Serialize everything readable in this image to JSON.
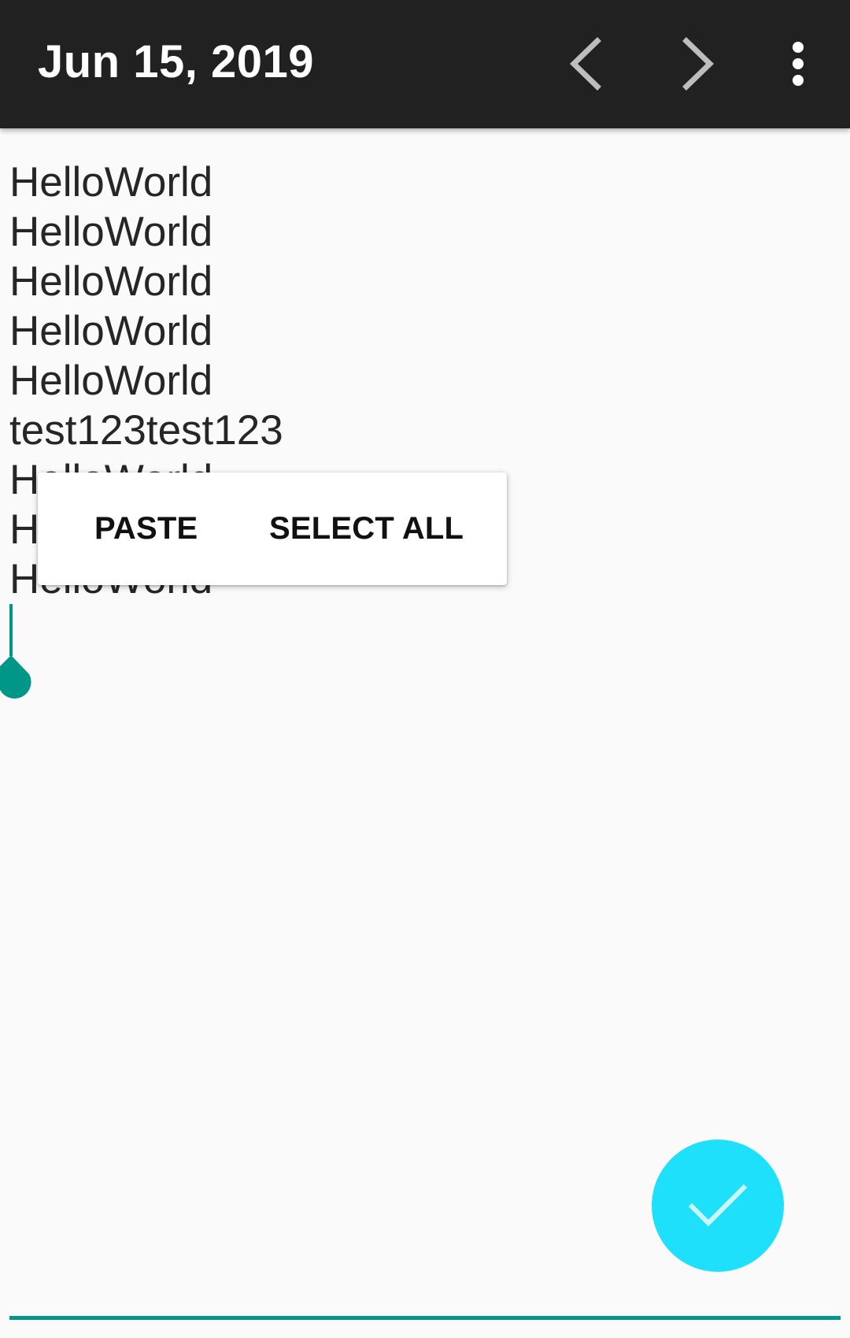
{
  "appbar": {
    "title": "Jun 15, 2019",
    "prev_icon": "chevron-left-icon",
    "next_icon": "chevron-right-icon",
    "more_icon": "more-vert-icon"
  },
  "editor": {
    "lines": [
      "HelloWorld",
      "HelloWorld",
      "HelloWorld",
      "HelloWorld",
      "HelloWorld",
      "test123test123",
      "HelloWorld",
      "HelloWorld",
      "HelloWorld"
    ],
    "accent_color": "#009688"
  },
  "context_menu": {
    "paste_label": "PASTE",
    "select_all_label": "SELECT ALL"
  },
  "fab": {
    "icon": "check-icon",
    "color": "#1fe0fa"
  },
  "colors": {
    "appbar": "#212121",
    "background": "#fafafa"
  }
}
